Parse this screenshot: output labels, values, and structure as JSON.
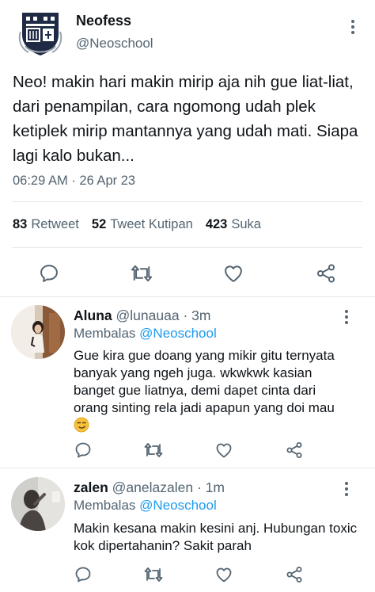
{
  "tweet": {
    "author_name": "Neofess",
    "author_handle": "@Neoschool",
    "text": "Neo! makin hari makin mirip aja nih gue liat-liat, dari penampilan, cara ngomong udah plek ketiplek mirip mantannya yang udah mati. Siapa lagi kalo bukan...",
    "time": "06:29 AM",
    "date": "26 Apr 23",
    "retweets_count": "83",
    "retweets_label": "Retweet",
    "quotes_count": "52",
    "quotes_label": "Tweet Kutipan",
    "likes_count": "423",
    "likes_label": "Suka"
  },
  "replies": [
    {
      "name": "Aluna",
      "handle": "@lunauaa",
      "time": "3m",
      "replying_prefix": "Membalas",
      "replying_to": "@Neoschool",
      "text": "Gue kira gue doang yang mikir gitu ternyata banyak yang ngeh juga. wkwkwk kasian banget gue liatnya, demi dapet cinta dari orang sinting rela jadi apapun yang doi mau",
      "emoji": "😏"
    },
    {
      "name": "zalen",
      "handle": "@anelazalen",
      "time": "1m",
      "replying_prefix": "Membalas",
      "replying_to": "@Neoschool",
      "text": "Makin kesana makin kesini anj. Hubungan toxic kok dipertahanin? Sakit parah"
    }
  ],
  "icons": {
    "reply": "comment-icon",
    "retweet": "retweet-icon",
    "like": "heart-icon",
    "share": "share-icon",
    "more": "more-vertical-icon"
  },
  "colors": {
    "text": "#0f1419",
    "secondary": "#536471",
    "accent": "#1d9bf0",
    "divider": "#e3e7ea"
  }
}
